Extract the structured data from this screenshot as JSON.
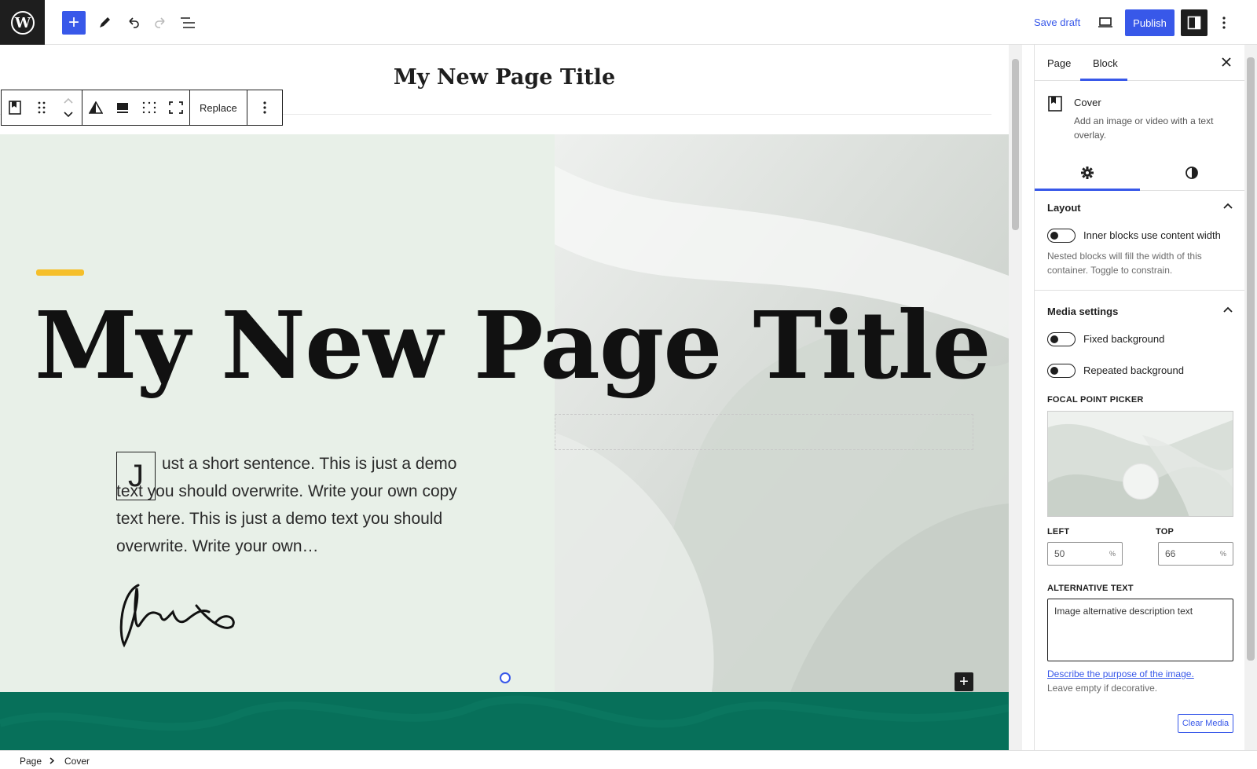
{
  "header": {
    "save_draft": "Save draft",
    "publish": "Publish"
  },
  "canvas": {
    "page_title": "My New Page Title",
    "cover_heading": "My New Page Title",
    "dropcap": "J",
    "body_text": "ust a short sentence. This is just a demo text you should overwrite. Write your own copy text here. This is just a demo text you should overwrite. Write your own…"
  },
  "block_toolbar": {
    "replace": "Replace"
  },
  "sidebar": {
    "tabs": [
      "Page",
      "Block"
    ],
    "active_tab": "Block",
    "block_name": "Cover",
    "block_description": "Add an image or video with a text overlay.",
    "layout": {
      "heading": "Layout",
      "toggle_label": "Inner blocks use content width",
      "help": "Nested blocks will fill the width of this container. Toggle to constrain."
    },
    "media": {
      "heading": "Media settings",
      "fixed_background": "Fixed background",
      "repeated_background": "Repeated background",
      "focal_point_label": "FOCAL POINT PICKER",
      "left_label": "LEFT",
      "left_value": "50",
      "top_label": "TOP",
      "top_value": "66",
      "unit": "%",
      "alt_label": "ALTERNATIVE TEXT",
      "alt_value": "Image alternative description text",
      "describe_link": "Describe the purpose of the image.",
      "describe_help": "Leave empty if decorative.",
      "clear_media": "Clear Media"
    }
  },
  "breadcrumb": [
    "Page",
    "Cover"
  ],
  "colors": {
    "accent": "#3858e9",
    "cover_left_bg": "#e8f0e8",
    "accent_bar": "#f5bf2a",
    "green_strip": "#07705a"
  }
}
